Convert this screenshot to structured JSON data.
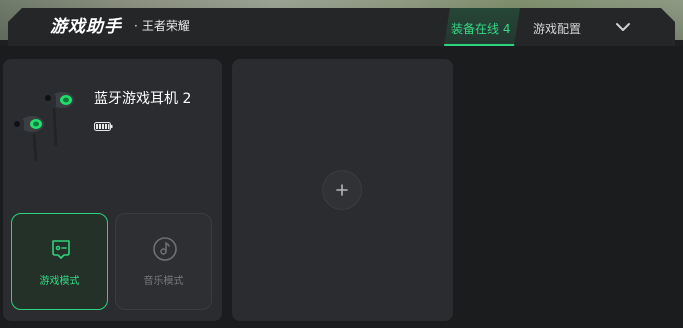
{
  "header": {
    "app_title": "游戏助手",
    "game_dot": "·",
    "game_name": "王者荣耀",
    "tabs": [
      {
        "label": "装备在线 4",
        "active": true
      },
      {
        "label": "游戏配置",
        "active": false
      }
    ],
    "expand_icon": "chevron-down-icon"
  },
  "device": {
    "name": "蓝牙游戏耳机 2",
    "battery_level": 1.0,
    "image_icon": "earbuds-image"
  },
  "modes": [
    {
      "label": "游戏模式",
      "icon": "gamepad-icon",
      "selected": true
    },
    {
      "label": "音乐模式",
      "icon": "music-disc-icon",
      "selected": false
    }
  ],
  "add_device": {
    "icon": "plus-icon"
  },
  "colors": {
    "accent": "#2fd37d",
    "panel": "#2a2c2f",
    "background": "#1b1c1e",
    "text": "#ffffff",
    "muted": "#77797c"
  }
}
